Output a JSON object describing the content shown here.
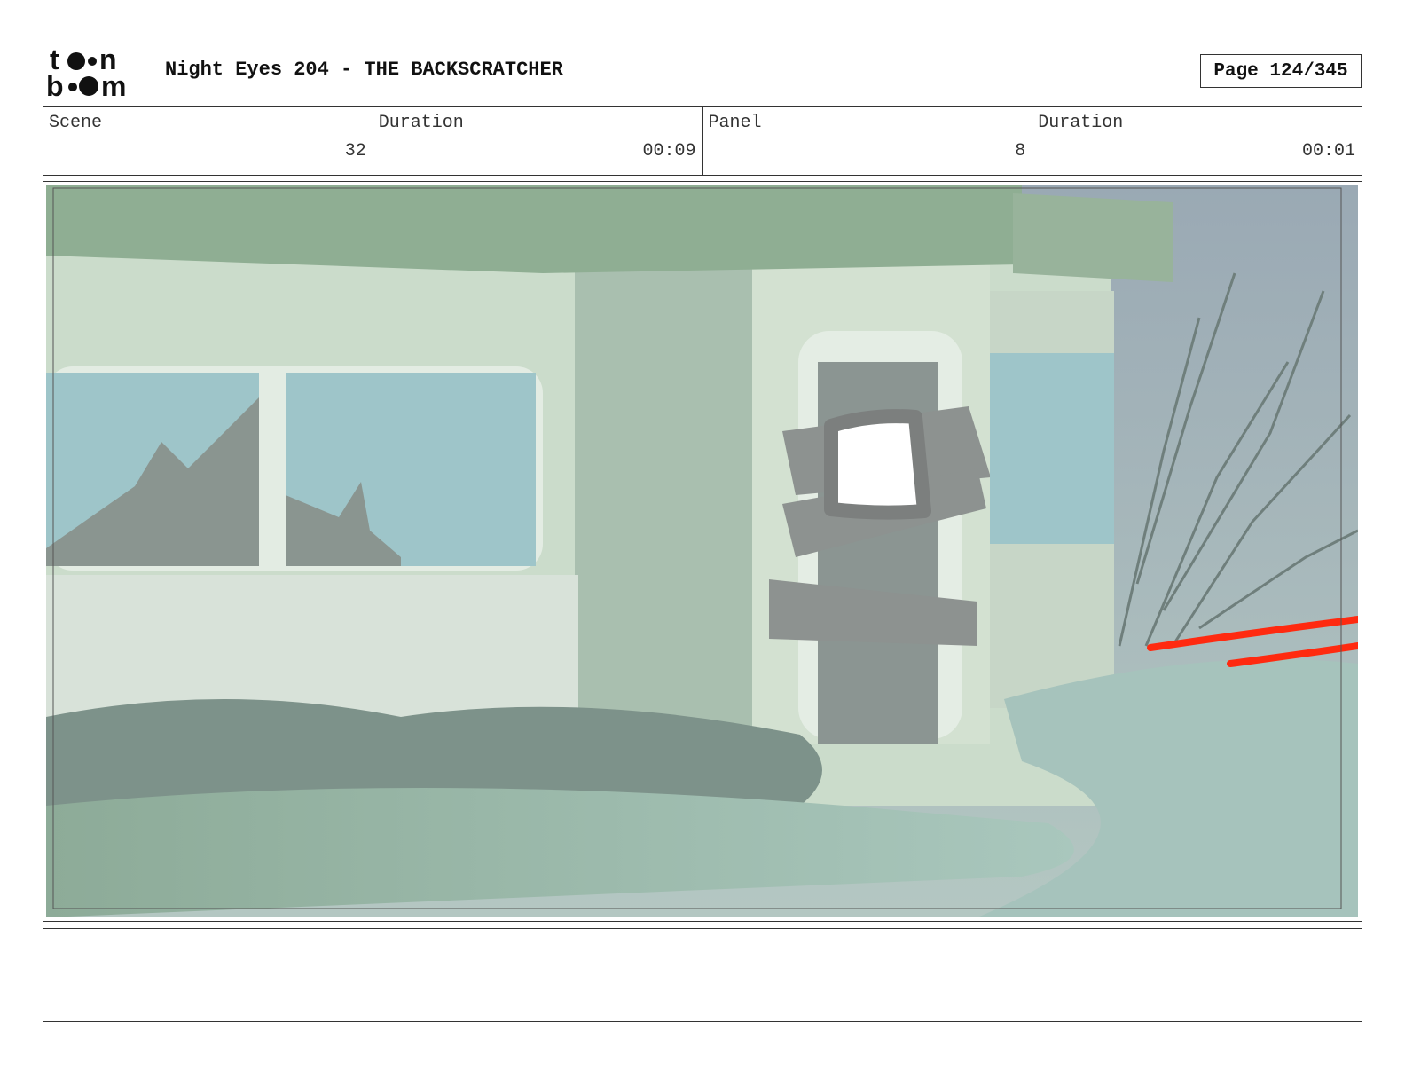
{
  "header": {
    "logo_text": "toon boom",
    "title": "Night Eyes 204 - THE BACKSCRATCHER",
    "page_label": "Page 124/345"
  },
  "info": {
    "scene_label": "Scene",
    "scene_value": "32",
    "scene_duration_label": "Duration",
    "scene_duration_value": "00:09",
    "panel_label": "Panel",
    "panel_value": "8",
    "panel_duration_label": "Duration",
    "panel_duration_value": "00:01"
  },
  "notes": {
    "text": ""
  },
  "colors": {
    "sky": "#9aaeb2",
    "building": "#c9dcc8",
    "window": "#9cc3c8",
    "grass": "#8fae9b",
    "board": "#8b8f8c",
    "red_stroke": "#ff2a10"
  }
}
